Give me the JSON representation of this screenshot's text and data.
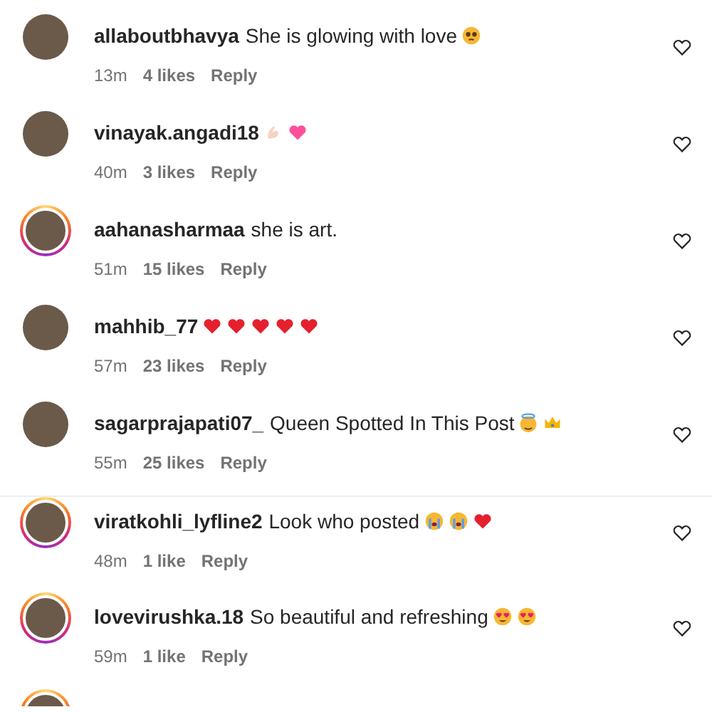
{
  "comments": [
    {
      "username": "allaboutbhavya",
      "text": "She is glowing with love",
      "emojis": [
        {
          "kind": "pleading"
        }
      ],
      "story_ring": false,
      "time": "13m",
      "likes": "4 likes",
      "reply": "Reply"
    },
    {
      "username": "vinayak.angadi18",
      "emojis": [
        {
          "kind": "hand"
        },
        {
          "kind": "pink-heart"
        }
      ],
      "story_ring": false,
      "time": "40m",
      "likes": "3 likes",
      "reply": "Reply"
    },
    {
      "username": "aahanasharmaa",
      "text": "she is art.",
      "story_ring": true,
      "time": "51m",
      "likes": "15 likes",
      "reply": "Reply"
    },
    {
      "username": "mahhib_77",
      "emojis": [
        {
          "kind": "red-heart"
        },
        {
          "kind": "red-heart"
        },
        {
          "kind": "red-heart"
        },
        {
          "kind": "red-heart"
        },
        {
          "kind": "red-heart"
        }
      ],
      "story_ring": false,
      "time": "57m",
      "likes": "23 likes",
      "reply": "Reply"
    },
    {
      "username": "sagarprajapati07_",
      "text": "Queen Spotted In This Post",
      "emojis": [
        {
          "kind": "halo"
        },
        {
          "kind": "crown"
        }
      ],
      "story_ring": false,
      "time": "55m",
      "likes": "25 likes",
      "reply": "Reply"
    },
    {
      "username": "viratkohli_lyfline2",
      "text": "Look who posted",
      "emojis": [
        {
          "kind": "crying"
        },
        {
          "kind": "crying"
        },
        {
          "kind": "red-heart"
        }
      ],
      "story_ring": true,
      "time": "48m",
      "likes": "1 like",
      "reply": "Reply"
    },
    {
      "username": "lovevirushka.18",
      "text": "So beautiful and refreshing",
      "emojis": [
        {
          "kind": "heart-eyes"
        },
        {
          "kind": "heart-eyes"
        }
      ],
      "story_ring": true,
      "time": "59m",
      "likes": "1 like",
      "reply": "Reply"
    },
    {
      "story_ring": true,
      "partial": true
    }
  ]
}
